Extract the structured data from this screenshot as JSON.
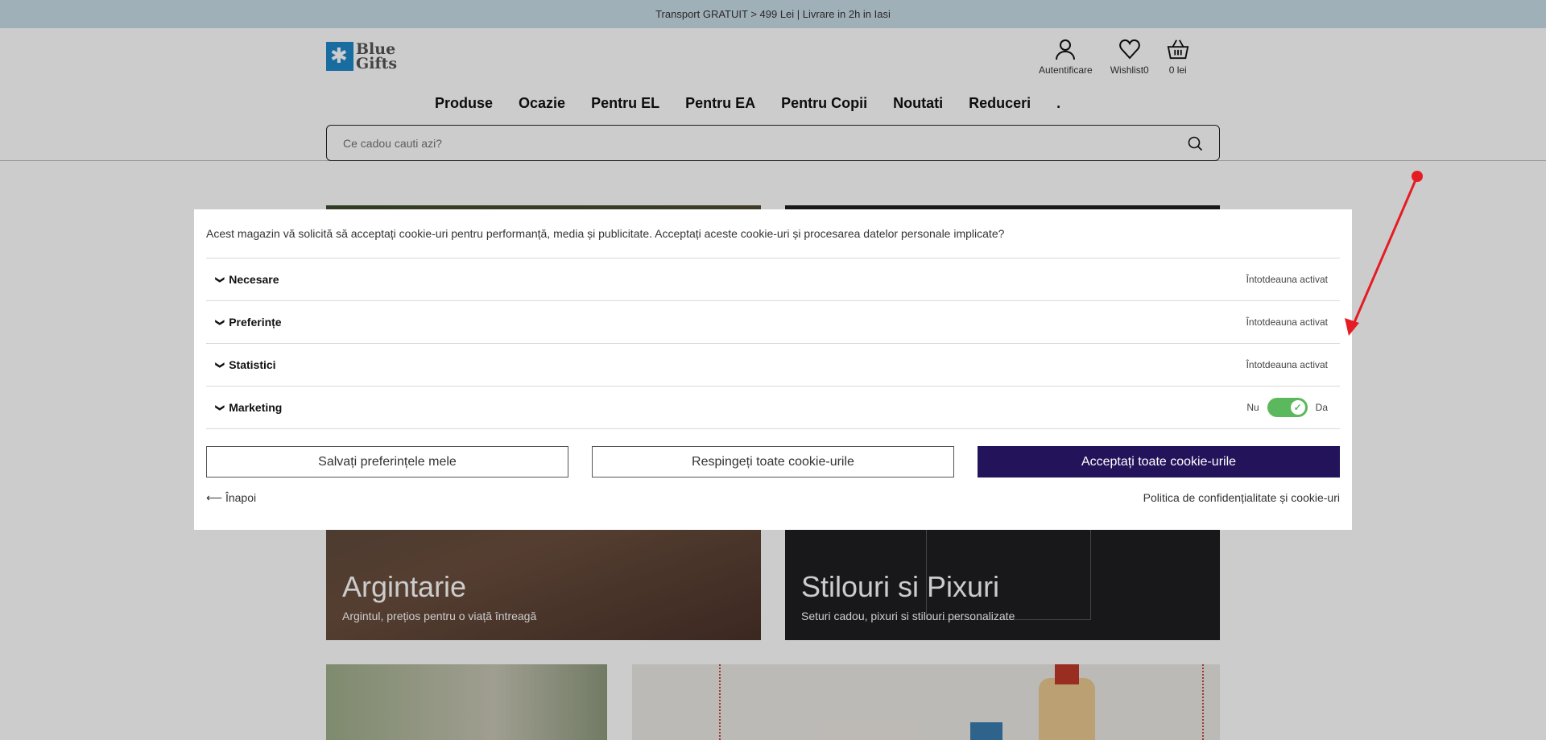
{
  "promo": {
    "text": "Transport GRATUIT > 499 Lei | Livrare in 2h in Iasi"
  },
  "logo": {
    "line1": "Blue",
    "line2": "Gifts"
  },
  "header_actions": {
    "login_label": "Autentificare",
    "wishlist_label": "Wishlist0",
    "cart_label": "0 lei"
  },
  "nav": [
    "Produse",
    "Ocazie",
    "Pentru EL",
    "Pentru EA",
    "Pentru Copii",
    "Noutati",
    "Reduceri",
    "."
  ],
  "search": {
    "placeholder": "Ce cadou cauti azi?"
  },
  "tiles": {
    "argintarie": {
      "title": "Argintarie",
      "subtitle": "Argintul, prețios pentru o viață întreagă"
    },
    "stilouri": {
      "title": "Stilouri si Pixuri",
      "subtitle": "Seturi cadou, pixuri si stilouri personalizate"
    }
  },
  "cookie": {
    "intro": "Acest magazin vă solicită să acceptați cookie-uri pentru performanță, media și publicitate. Acceptați aceste cookie-uri și procesarea datelor personale implicate?",
    "categories": [
      {
        "title": "Necesare",
        "status": "Întotdeauna activat"
      },
      {
        "title": "Preferințe",
        "status": "Întotdeauna activat"
      },
      {
        "title": "Statistici",
        "status": "Întotdeauna activat"
      },
      {
        "title": "Marketing",
        "toggle_off_label": "Nu",
        "toggle_on_label": "Da",
        "enabled": true
      }
    ],
    "buttons": {
      "save": "Salvați preferințele mele",
      "reject": "Respingeți toate cookie-urile",
      "accept": "Acceptați toate cookie-urile"
    },
    "back_label": "⟵ Înapoi",
    "policy_label": "Politica de confidențialitate și cookie-uri"
  },
  "colors": {
    "promo_bg": "#c8dce8",
    "accept_button": "#23135a",
    "toggle_on": "#5cb85c",
    "annotation_arrow": "#e51c23"
  }
}
